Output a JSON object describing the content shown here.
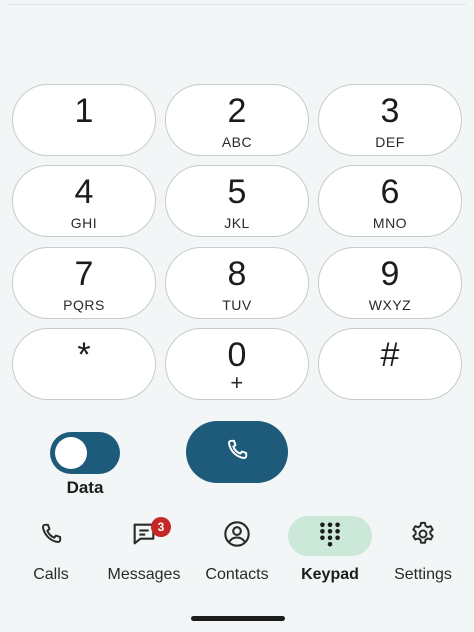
{
  "keypad": {
    "keys": [
      {
        "digit": "1",
        "letters": ""
      },
      {
        "digit": "2",
        "letters": "ABC"
      },
      {
        "digit": "3",
        "letters": "DEF"
      },
      {
        "digit": "4",
        "letters": "GHI"
      },
      {
        "digit": "5",
        "letters": "JKL"
      },
      {
        "digit": "6",
        "letters": "MNO"
      },
      {
        "digit": "7",
        "letters": "PQRS"
      },
      {
        "digit": "8",
        "letters": "TUV"
      },
      {
        "digit": "9",
        "letters": "WXYZ"
      },
      {
        "digit": "*",
        "letters": ""
      },
      {
        "digit": "0",
        "letters": "+"
      },
      {
        "digit": "#",
        "letters": ""
      }
    ]
  },
  "controls": {
    "data_label": "Data",
    "data_toggle_on": true,
    "call_icon": "phone-icon"
  },
  "nav": {
    "items": [
      {
        "label": "Calls",
        "icon": "phone-icon",
        "active": false
      },
      {
        "label": "Messages",
        "icon": "message-icon",
        "active": false,
        "badge": "3"
      },
      {
        "label": "Contacts",
        "icon": "account-icon",
        "active": false
      },
      {
        "label": "Keypad",
        "icon": "dialpad-icon",
        "active": true
      },
      {
        "label": "Settings",
        "icon": "gear-icon",
        "active": false
      }
    ]
  },
  "colors": {
    "accent": "#1e5a7a",
    "active_nav_bg": "#cce8d9",
    "badge": "#c62828",
    "background": "#f3f6f6"
  }
}
